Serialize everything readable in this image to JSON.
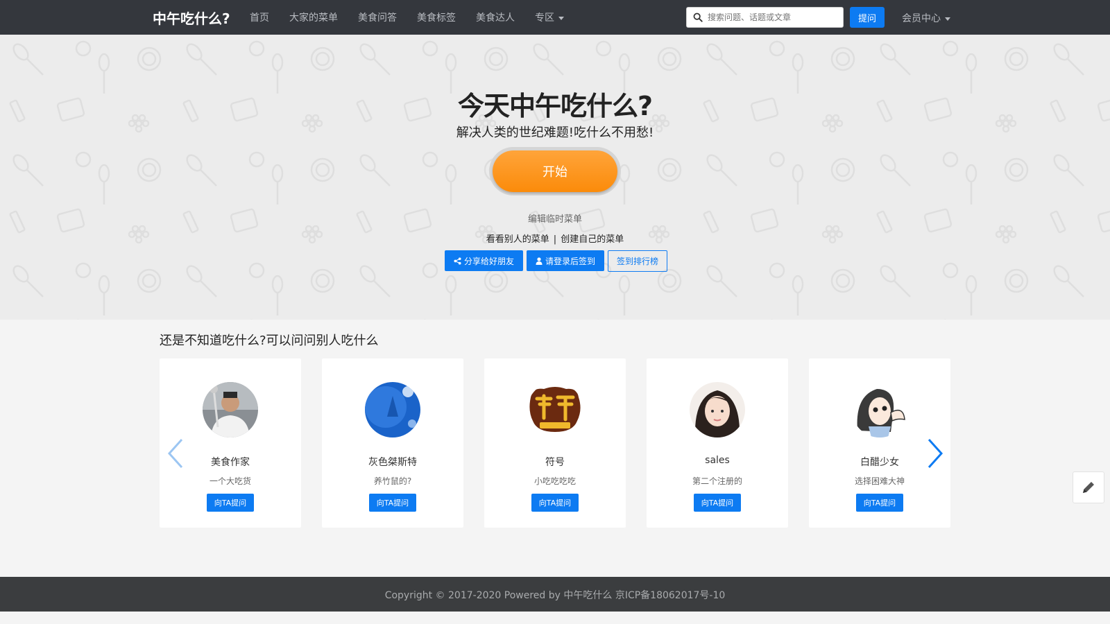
{
  "navbar": {
    "brand": "中午吃什么?",
    "links": [
      "首页",
      "大家的菜单",
      "美食问答",
      "美食标签",
      "美食达人",
      "专区"
    ],
    "search_placeholder": "搜索问题、话题或文章",
    "ask_label": "提问",
    "member_label": "会员中心"
  },
  "hero": {
    "title": "今天中午吃什么?",
    "subtitle": "解决人类的世纪难题!吃什么不用愁!",
    "start_label": "开始",
    "edit_menu_label": "编辑临时菜单",
    "view_others_label": "看看别人的菜单",
    "separator": "|",
    "create_own_label": "创建自己的菜单",
    "share_label": "分享给好朋友",
    "login_checkin_label": "请登录后签到",
    "ranking_label": "签到排行榜"
  },
  "section": {
    "title": "还是不知道吃什么?可以问问别人吃什么",
    "cards": [
      {
        "name": "美食作家",
        "desc": "一个大吃货",
        "button": "向TA提问"
      },
      {
        "name": "灰色桀斯特",
        "desc": "养竹鼠的?",
        "button": "向TA提问"
      },
      {
        "name": "符号",
        "desc": "小吃吃吃吃",
        "button": "向TA提问"
      },
      {
        "name": "sales",
        "desc": "第二个注册的",
        "button": "向TA提问"
      },
      {
        "name": "白醋少女",
        "desc": "选择困难大神",
        "button": "向TA提问"
      }
    ]
  },
  "footer": {
    "text": "Copyright © 2017-2020 Powered by 中午吃什么 京ICP备18062017号-10"
  },
  "colors": {
    "navbar": "#34373d",
    "primary": "#0d7bf2",
    "start_button": "#fb8b0a",
    "footer": "#3b3d3f"
  }
}
